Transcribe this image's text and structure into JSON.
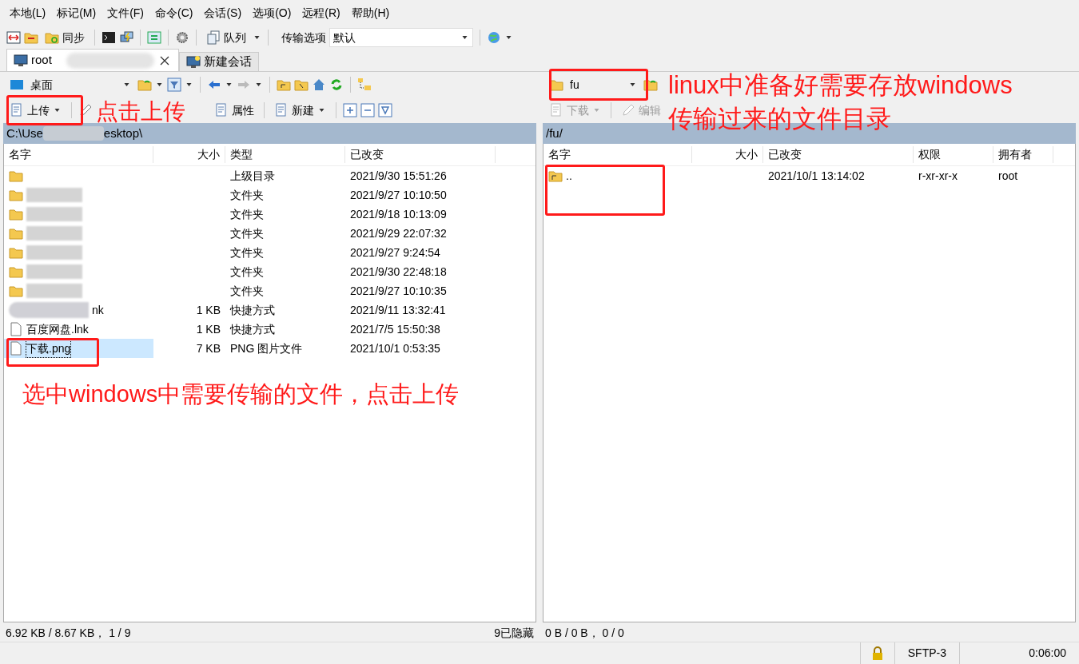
{
  "menu": [
    "本地(L)",
    "标记(M)",
    "文件(F)",
    "命令(C)",
    "会话(S)",
    "选项(O)",
    "远程(R)",
    "帮助(H)"
  ],
  "toolbar": {
    "sync": "同步",
    "queue": "队列",
    "transfer_label": "传输选项",
    "transfer_value": "默认"
  },
  "tabs": [
    {
      "label": "root",
      "selected": true
    },
    {
      "label": "新建会话",
      "selected": false
    }
  ],
  "left": {
    "location": "桌面",
    "actions": [
      {
        "label": "上传",
        "kind": "dropdown",
        "disabled": false
      },
      {
        "label": "属性",
        "kind": "plain",
        "disabled": false
      },
      {
        "label": "新建",
        "kind": "dropdown",
        "disabled": false
      }
    ],
    "path_start": "C:\\Use",
    "path_end": "esktop\\",
    "columns": [
      "名字",
      "大小",
      "类型",
      "已改变"
    ],
    "rows": [
      {
        "kind": "parent",
        "size": "",
        "type": "上级目录",
        "modified": "2021/9/30  15:51:26",
        "selected": false
      },
      {
        "kind": "hidden",
        "size": "",
        "type": "文件夹",
        "modified": "2021/9/27  10:10:50",
        "selected": false
      },
      {
        "kind": "hidden",
        "size": "",
        "type": "文件夹",
        "modified": "2021/9/18  10:13:09",
        "selected": false
      },
      {
        "kind": "hidden",
        "size": "",
        "type": "文件夹",
        "modified": "2021/9/29  22:07:32",
        "selected": false
      },
      {
        "kind": "hidden",
        "size": "",
        "type": "文件夹",
        "modified": "2021/9/27  9:24:54",
        "selected": false
      },
      {
        "kind": "hidden",
        "size": "",
        "type": "文件夹",
        "modified": "2021/9/30  22:48:18",
        "selected": false
      },
      {
        "kind": "hidden",
        "size": "",
        "type": "文件夹",
        "modified": "2021/9/27  10:10:35",
        "selected": false
      },
      {
        "kind": "partial",
        "name": "nk",
        "size": "1 KB",
        "type": "快捷方式",
        "modified": "2021/9/11  13:32:41",
        "selected": false
      },
      {
        "kind": "file",
        "name": "百度网盘.lnk",
        "size": "1 KB",
        "type": "快捷方式",
        "modified": "2021/7/5  15:50:38",
        "selected": false
      },
      {
        "kind": "file",
        "name": "下载.png",
        "size": "7 KB",
        "type": "PNG 图片文件",
        "modified": "2021/10/1  0:53:35",
        "selected": true
      }
    ],
    "status": "6.92 KB / 8.67 KB， 1 / 9",
    "hidden": "9已隐藏"
  },
  "right": {
    "location": "fu",
    "actions": [
      {
        "label": "下载",
        "kind": "dropdown",
        "disabled": true
      },
      {
        "label": "编辑",
        "kind": "plain",
        "disabled": true
      }
    ],
    "path": "/fu/",
    "columns": [
      "名字",
      "大小",
      "已改变",
      "权限",
      "拥有者"
    ],
    "rows": [
      {
        "name": "..",
        "size": "",
        "modified": "2021/10/1 13:14:02",
        "rights": "r-xr-xr-x",
        "owner": "root",
        "selected": false
      }
    ],
    "status": "0 B / 0 B， 0 / 0"
  },
  "bottom": {
    "protocol": "SFTP-3",
    "time": "0:06:00"
  },
  "annotations": [
    {
      "text": "点击上传",
      "kind": "upload"
    },
    {
      "text": "选中windows中需要传输的文件，点击上传",
      "kind": "file"
    },
    {
      "text": "linux中准备好需要存放windows\n传输过来的文件目录",
      "kind": "folder"
    }
  ]
}
